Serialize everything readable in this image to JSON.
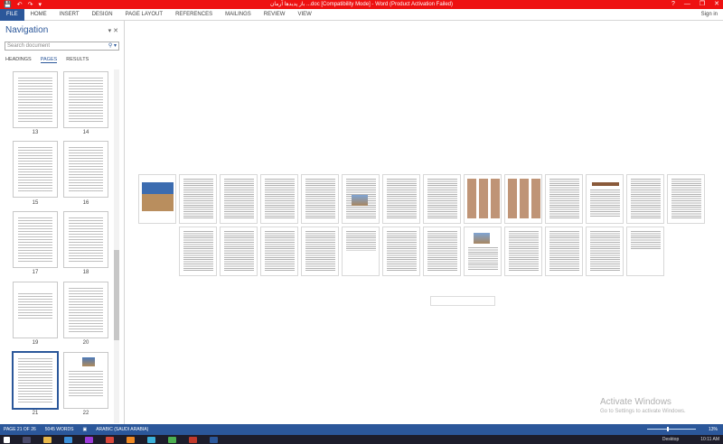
{
  "window": {
    "title": "باز پديدها آرمان ...doc [Compatibility Mode] - Word (Product Activation Failed)",
    "controls": [
      "?",
      "—",
      "❐",
      "✕"
    ]
  },
  "qat": [
    "💾",
    "↶",
    "↷",
    "▾"
  ],
  "ribbon": {
    "file_label": "FILE",
    "tabs": [
      "HOME",
      "INSERT",
      "DESIGN",
      "PAGE LAYOUT",
      "REFERENCES",
      "MAILINGS",
      "REVIEW",
      "VIEW"
    ],
    "signin": "Sign in"
  },
  "navigation": {
    "title": "Navigation",
    "close": "▾ ✕",
    "search_placeholder": "Search document",
    "tabs": [
      "HEADINGS",
      "PAGES",
      "RESULTS"
    ],
    "active_tab": "PAGES",
    "thumbnails": [
      {
        "num": "13"
      },
      {
        "num": "14"
      },
      {
        "num": "15"
      },
      {
        "num": "16"
      },
      {
        "num": "17"
      },
      {
        "num": "18"
      },
      {
        "num": "19"
      },
      {
        "num": "20"
      },
      {
        "num": "21",
        "selected": true
      },
      {
        "num": "22"
      }
    ]
  },
  "watermark": {
    "line1": "Activate Windows",
    "line2": "Go to Settings to activate Windows."
  },
  "statusbar": {
    "page": "PAGE 21 OF 26",
    "words": "5045 WORDS",
    "language": "ARABIC (SAUDI ARABIA)",
    "zoom": "13%"
  },
  "taskbar": {
    "desktop": "Desktop",
    "time": "10:11 AM"
  },
  "colors": {
    "title_red": "#ee1111",
    "word_blue": "#2b579a"
  }
}
